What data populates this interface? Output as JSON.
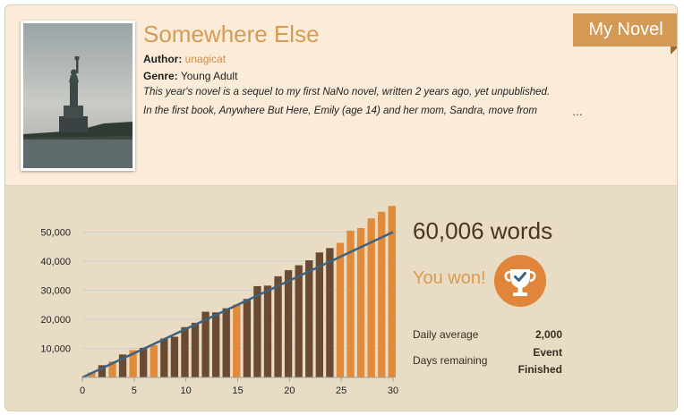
{
  "novel": {
    "title": "Somewhere Else",
    "author_label": "Author:",
    "author_name": "unagicat",
    "genre_label": "Genre:",
    "genre": "Young Adult",
    "synopsis_line1": "This year's novel is a sequel to my first NaNo novel, written 2 years ago, yet unpublished.",
    "synopsis_line2": "In the first book, Anywhere But Here, Emily (age 14) and her mom, Sandra, move from",
    "ellipsis": "…"
  },
  "ribbon": {
    "label": "My Novel"
  },
  "stats": {
    "words": "60,006 words",
    "won_text": "You won!",
    "daily_average_label": "Daily average",
    "daily_average_value": "2,000",
    "days_remaining_label": "Days remaining",
    "days_remaining_value_line1": "Event",
    "days_remaining_value_line2": "Finished"
  },
  "icons": {
    "trophy": "trophy-check-icon"
  },
  "colors": {
    "accent": "#d79a55",
    "bar_dark": "#6b4a32",
    "bar_orange": "#e08a3a",
    "goal_line": "#3d6280"
  },
  "chart_data": {
    "type": "bar",
    "x": [
      1,
      2,
      3,
      4,
      5,
      6,
      7,
      8,
      9,
      10,
      11,
      12,
      13,
      14,
      15,
      16,
      17,
      18,
      19,
      20,
      21,
      22,
      23,
      24,
      25,
      26,
      27,
      28,
      29,
      30
    ],
    "values": [
      1700,
      4200,
      5500,
      7900,
      9400,
      10200,
      11100,
      13400,
      14000,
      17300,
      18800,
      22600,
      22400,
      23800,
      25100,
      27000,
      31400,
      31600,
      34800,
      36900,
      38600,
      40300,
      43000,
      44500,
      46300,
      50500,
      51400,
      54700,
      57000,
      59000
    ],
    "bar_colors": [
      "orange",
      "dark",
      "orange",
      "dark",
      "orange",
      "dark",
      "orange",
      "dark",
      "dark",
      "dark",
      "dark",
      "dark",
      "dark",
      "dark",
      "orange",
      "dark",
      "dark",
      "dark",
      "dark",
      "dark",
      "dark",
      "dark",
      "dark",
      "dark",
      "orange",
      "orange",
      "orange",
      "orange",
      "orange",
      "orange"
    ],
    "goal_line": {
      "x": [
        0,
        30
      ],
      "y": [
        0,
        50000
      ]
    },
    "xticks": [
      0,
      5,
      10,
      15,
      20,
      25,
      30
    ],
    "yticks": [
      10000,
      20000,
      30000,
      40000,
      50000
    ],
    "ytick_labels": [
      "10,000",
      "20,000",
      "30,000",
      "40,000",
      "50,000"
    ],
    "xlim": [
      0,
      30
    ],
    "ylim": [
      0,
      60000
    ],
    "grid": true
  }
}
